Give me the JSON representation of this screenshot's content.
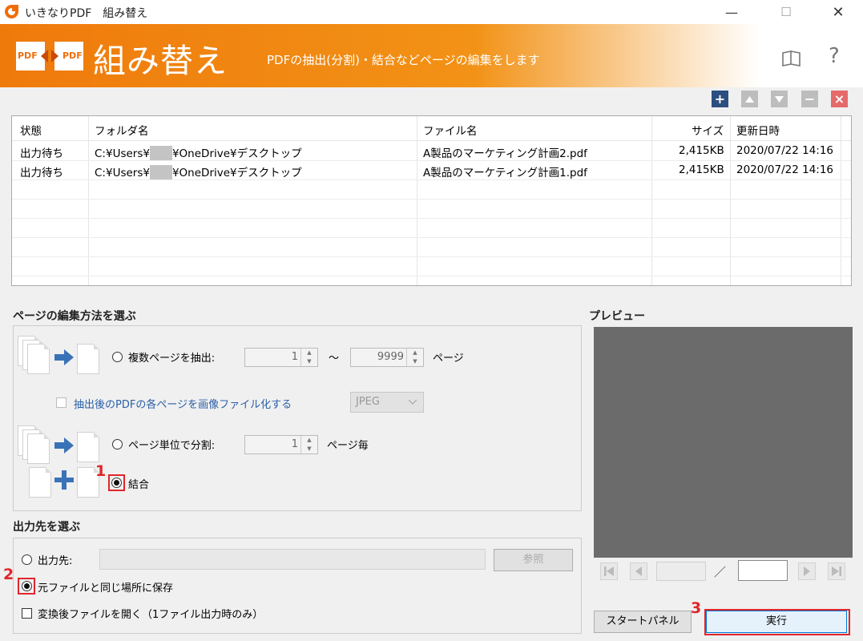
{
  "window": {
    "title": "いきなりPDF　組み替え",
    "minimize": "—",
    "maximize": "☐",
    "close": "✕"
  },
  "header": {
    "logo_left": "PDF",
    "logo_right": "PDF",
    "title": "組み替え",
    "description": "PDFの抽出(分割)・結合などページの編集をします",
    "help": "?"
  },
  "toolbar": {
    "add": "+",
    "remove": "−",
    "delete": "×"
  },
  "file_list": {
    "columns": [
      "状態",
      "フォルダ名",
      "ファイル名",
      "サイズ",
      "更新日時"
    ],
    "rows": [
      {
        "status": "出力待ち",
        "folder_prefix": "C:¥Users¥",
        "folder_suffix": "¥OneDrive¥デスクトップ",
        "file": "A製品のマーケティング計画2.pdf",
        "size": "2,415KB",
        "date": "2020/07/22  14:16"
      },
      {
        "status": "出力待ち",
        "folder_prefix": "C:¥Users¥",
        "folder_suffix": "¥OneDrive¥デスクトップ",
        "file": "A製品のマーケティング計画1.pdf",
        "size": "2,415KB",
        "date": "2020/07/22  14:16"
      }
    ]
  },
  "edit_method": {
    "title": "ページの編集方法を選ぶ",
    "extract_label": "複数ページを抽出:",
    "extract_from": "1",
    "tilde": "〜",
    "extract_to": "9999",
    "page_unit": "ページ",
    "to_image_label": "抽出後のPDFの各ページを画像ファイル化する",
    "image_format": "JPEG",
    "split_label": "ページ単位で分割:",
    "split_value": "1",
    "split_unit": "ページ毎",
    "merge_label": "結合"
  },
  "output": {
    "title": "出力先を選ぶ",
    "dest_label": "出力先:",
    "dest_value": "",
    "browse": "参照",
    "same_place_label": "元ファイルと同じ場所に保存",
    "open_after_label": "変換後ファイルを開く（1ファイル出力時のみ）"
  },
  "preview": {
    "title": "プレビュー",
    "current_page": "",
    "separator": "／",
    "total_pages": ""
  },
  "buttons": {
    "start_panel": "スタートパネル",
    "execute": "実行"
  },
  "annotations": {
    "step1": "1",
    "step2": "2",
    "step3": "3",
    "color": "#e0262a"
  },
  "colors": {
    "header_orange": "#ef7a0c",
    "toolbar_blue": "#2b4f80"
  }
}
